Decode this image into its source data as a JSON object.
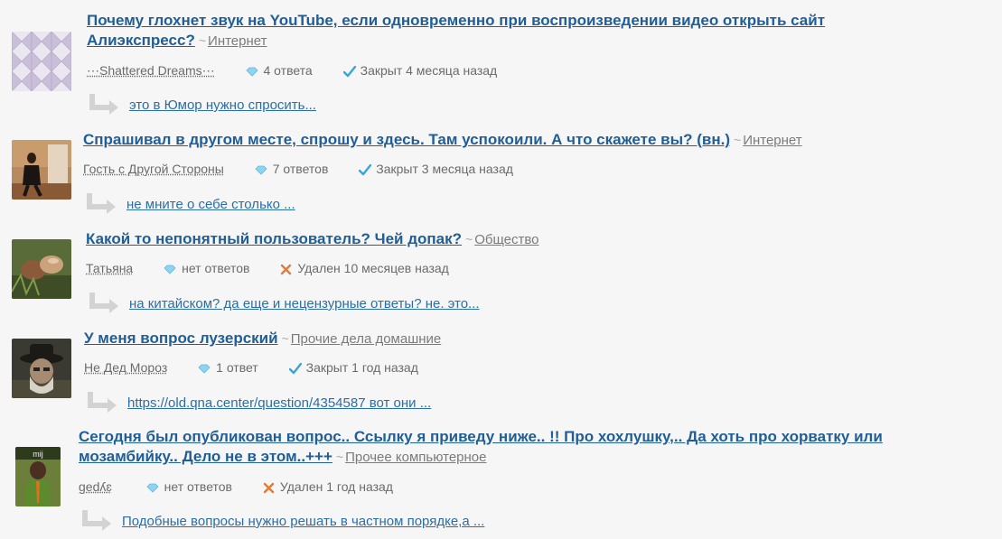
{
  "questions": [
    {
      "title": "Почему глохнет звук на YouTube, если одновременно при воспроизведении видео открыть сайт",
      "title_line2": "Алиэкспресс?",
      "category": "Интернет",
      "author": "⋯Shattered Dreams⋯",
      "answers": "4 ответа",
      "status": "Закрыт 4 месяца назад",
      "status_icon": "check-icon",
      "reply": "это в Юмор нужно спросить..."
    },
    {
      "title": "Спрашивал в другом месте, спрошу и здесь. Там успокоили. А что скажете вы? (вн.)",
      "category": "Интернет",
      "author": "Гость с Другой Стороны",
      "answers": "7 ответов",
      "status": "Закрыт 3 месяца назад",
      "status_icon": "check-icon",
      "reply": "не мните о себе столько ..."
    },
    {
      "title": "Какой то непонятный пользователь? Чей допак?",
      "category": "Общество",
      "author": "Татьяна",
      "answers": "нет ответов",
      "status": "Удален 10 месяцев назад",
      "status_icon": "cross-icon",
      "reply": "на китайском? да еще и нецензурные ответы? не. это..."
    },
    {
      "title": "У меня вопрос лузерский",
      "category": "Прочие дела домашние",
      "author": "Не Дед Мороз",
      "answers": "1 ответ",
      "status": "Закрыт 1 год назад",
      "status_icon": "check-icon",
      "reply": "https://old.qna.center/question/4354587 вот они ..."
    },
    {
      "title": "Сегодня был опубликован вопрос.. Ссылку я приведу ниже.. !! Про хохлушку,.. Да хоть про хорватку или",
      "title_line2": "мозамбийку.. Дело не в этом..+++",
      "category": "Прочее компьютерное",
      "author": "gedʎɛ",
      "answers": "нет ответов",
      "status": "Удален 1 год назад",
      "status_icon": "cross-icon",
      "reply": "Подобные вопросы нужно решать в частном порядке,а ..."
    }
  ],
  "colors": {
    "title": "#1f5e97",
    "link": "#2a6ea8",
    "meta": "#6b6b6b",
    "check": "#3aa3d9",
    "cross": "#e07b39",
    "answers_icon": "#8fd3f0"
  }
}
